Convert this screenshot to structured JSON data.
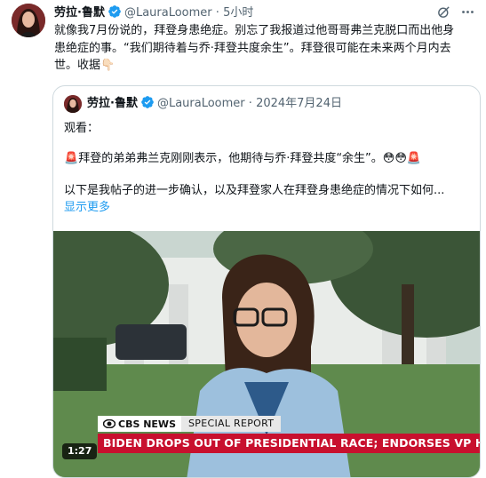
{
  "tweet": {
    "author_name": "劳拉·鲁默",
    "handle": "@LauraLoomer",
    "separator": "·",
    "time": "5小时",
    "text_line1": "就像我7月份说的，拜登身患绝症。别忘了我报道过他哥哥弗兰克脱口而出他身",
    "text_line2": "患绝症的事。“我们期待着与乔·拜登共度余生”。拜登很可能在未来两个月内去",
    "text_line3": "世。收据",
    "text_emoji": "👇🏻"
  },
  "quote": {
    "author_name": "劳拉·鲁默",
    "handle": "@LauraLoomer",
    "separator": "·",
    "date": "2024年7月24日",
    "line1": "观看：",
    "line2_emoji_start": "🚨",
    "line2": "拜登的弟弟弗兰克刚刚表示，他期待与乔·拜登共度“余生”。",
    "line2_emoji_end": "😳😳🚨",
    "line3": "以下是我帖子的进一步确认，以及拜登家人在拜登身患绝症的情况下如何...",
    "show_more": "显示更多"
  },
  "video": {
    "network": "CBS NEWS",
    "segment": "SPECIAL REPORT",
    "headline": "BIDEN DROPS OUT OF PRESIDENTIAL RACE; ENDORSES VP HARRIS",
    "duration": "1:27"
  },
  "icons": {
    "verified": "verified-badge-icon",
    "grok": "grok-icon",
    "more": "more-options-icon"
  },
  "colors": {
    "verified_blue": "#1d9bf0",
    "link_blue": "#1d9bf0",
    "muted_text": "#536471",
    "banner_red": "#c8102e"
  }
}
